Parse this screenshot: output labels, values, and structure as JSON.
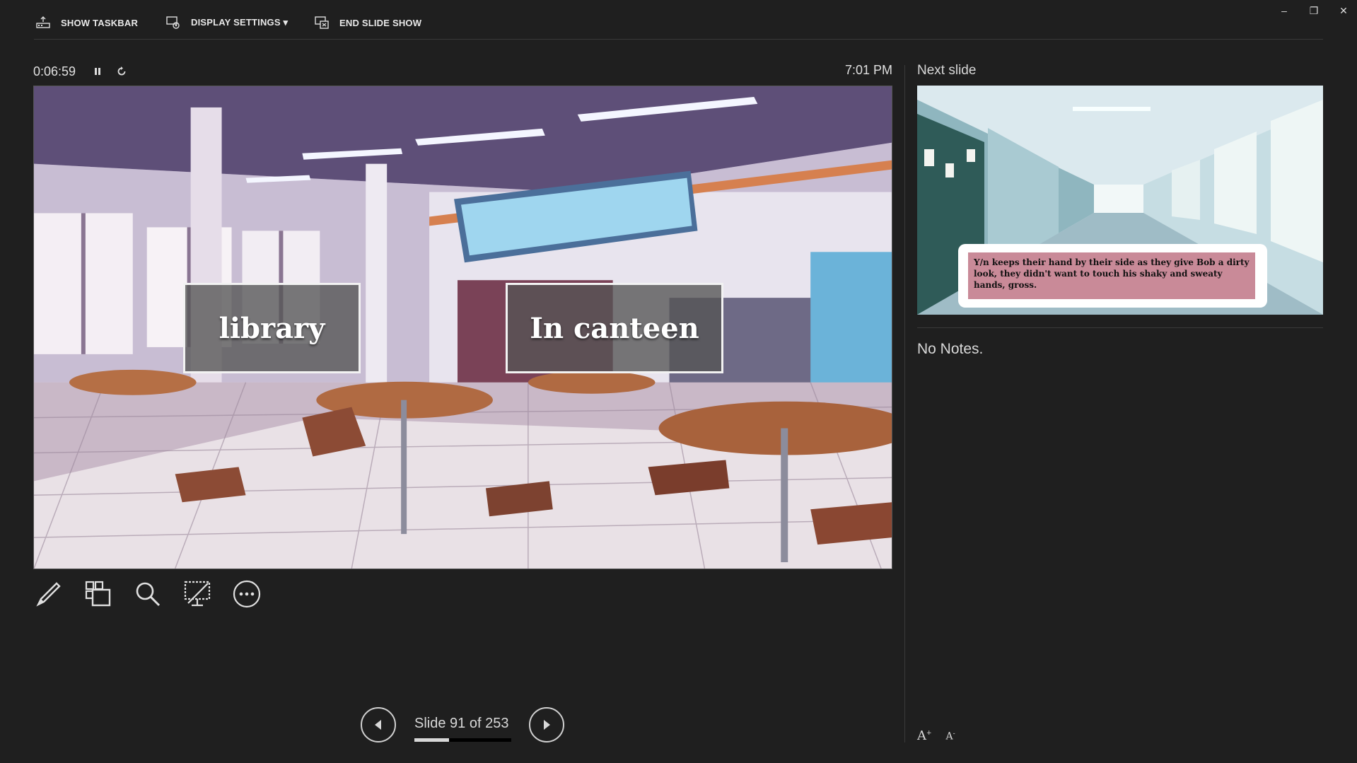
{
  "toolbar": {
    "show_taskbar": "SHOW TASKBAR",
    "display_settings": "DISPLAY SETTINGS ▾",
    "end_slide_show": "END SLIDE SHOW"
  },
  "window_controls": {
    "minimize": "–",
    "restore": "❐",
    "close": "✕"
  },
  "presenter": {
    "elapsed_time": "0:06:59",
    "clock": "7:01 PM"
  },
  "current_slide": {
    "choices": [
      "library",
      "In canteen"
    ]
  },
  "next_slide": {
    "label": "Next slide",
    "dialog_text": "Y/n keeps their hand by their side as they give Bob a dirty look, they didn't want to touch his shaky and sweaty hands, gross."
  },
  "notes": {
    "text": "No Notes."
  },
  "navigation": {
    "slide_counter": "Slide 91 of 253",
    "current": 91,
    "total": 253,
    "progress_fraction": 0.36
  },
  "font_controls": {
    "increase": "A",
    "decrease": "A"
  },
  "colors": {
    "background": "#1f1f1f",
    "text": "#e6e6e6",
    "dialog_fill": "#c98a98"
  }
}
